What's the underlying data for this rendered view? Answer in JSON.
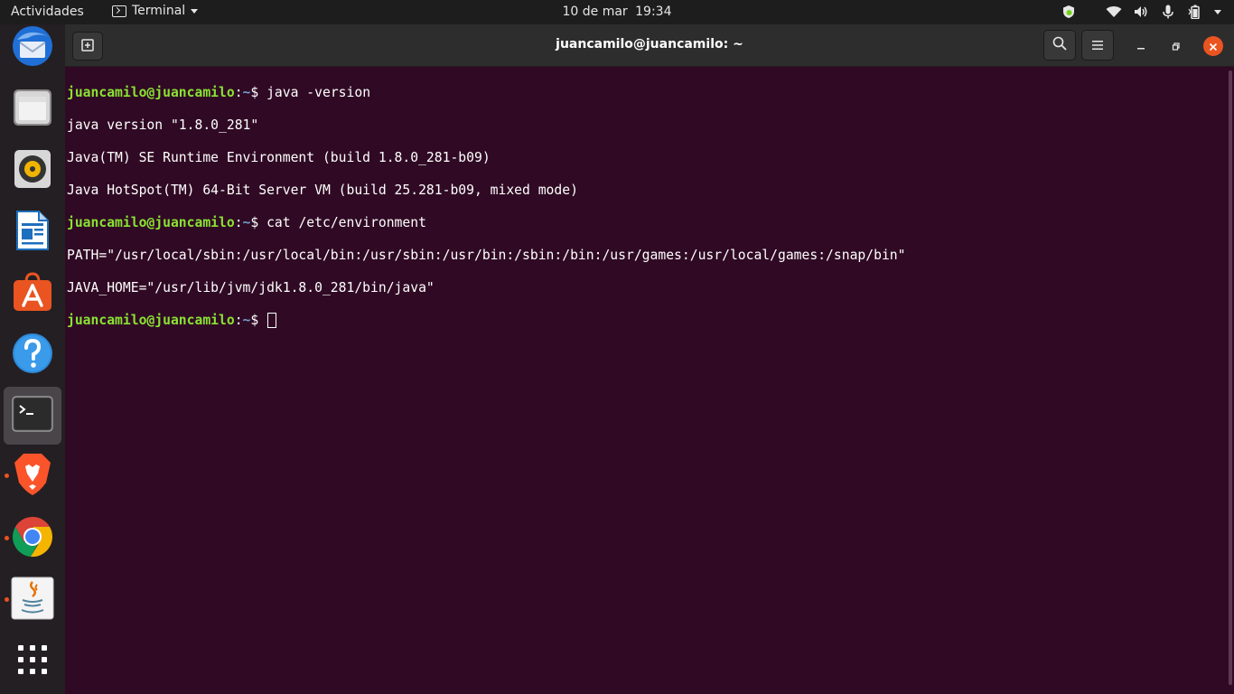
{
  "topbar": {
    "activities": "Actividades",
    "app_name": "Terminal",
    "date": "10 de mar",
    "time": "19:34",
    "tray_icons": [
      "shield-update-icon",
      "wifi-icon",
      "volume-icon",
      "microphone-icon",
      "battery-icon",
      "system-menu-icon"
    ]
  },
  "dock": {
    "items": [
      {
        "name": "thunderbird",
        "icon": "thunderbird-icon",
        "running": false,
        "active": false
      },
      {
        "name": "files",
        "icon": "files-icon",
        "running": false,
        "active": false
      },
      {
        "name": "rhythmbox",
        "icon": "rhythmbox-icon",
        "running": false,
        "active": false
      },
      {
        "name": "libreoffice-writer",
        "icon": "libreoffice-writer-icon",
        "running": false,
        "active": false
      },
      {
        "name": "ubuntu-software",
        "icon": "ubuntu-software-icon",
        "running": false,
        "active": false
      },
      {
        "name": "help",
        "icon": "help-icon",
        "running": false,
        "active": false
      },
      {
        "name": "terminal",
        "icon": "terminal-icon",
        "running": true,
        "active": true
      },
      {
        "name": "brave",
        "icon": "brave-icon",
        "running": true,
        "active": false
      },
      {
        "name": "chrome",
        "icon": "chrome-icon",
        "running": true,
        "active": false
      },
      {
        "name": "java",
        "icon": "java-icon",
        "running": true,
        "active": false
      },
      {
        "name": "show-apps",
        "icon": "app-grid-icon",
        "running": false,
        "active": false
      }
    ]
  },
  "window": {
    "title": "juancamilo@juancamilo: ~"
  },
  "terminal": {
    "prompt_user": "juancamilo@juancamilo",
    "prompt_sep": ":",
    "prompt_path": "~",
    "prompt_symbol": "$ ",
    "cmd1": "java -version",
    "out1": "java version \"1.8.0_281\"",
    "out2": "Java(TM) SE Runtime Environment (build 1.8.0_281-b09)",
    "out3": "Java HotSpot(TM) 64-Bit Server VM (build 25.281-b09, mixed mode)",
    "cmd2": "cat /etc/environment",
    "out4": "PATH=\"/usr/local/sbin:/usr/local/bin:/usr/sbin:/usr/bin:/sbin:/bin:/usr/games:/usr/local/games:/snap/bin\"",
    "out5": "JAVA_HOME=\"/usr/lib/jvm/jdk1.8.0_281/bin/java\""
  },
  "colors": {
    "terminal_bg": "#300a24",
    "prompt_user": "#8ae234",
    "prompt_path": "#729fcf",
    "accent": "#e95420"
  }
}
